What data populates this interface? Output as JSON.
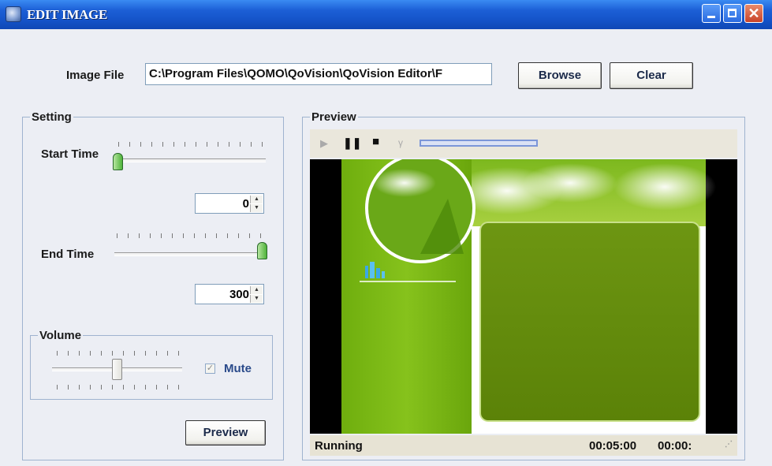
{
  "window": {
    "title": "EDIT IMAGE"
  },
  "image_file": {
    "label": "Image File",
    "value": "C:\\Program Files\\QOMO\\QoVision\\QoVision Editor\\F",
    "browse_label": "Browse",
    "clear_label": "Clear"
  },
  "setting": {
    "title": "Setting",
    "start_time_label": "Start Time",
    "start_time_value": "0",
    "end_time_label": "End Time",
    "end_time_value": "300",
    "volume_title": "Volume",
    "mute_label": "Mute",
    "mute_checked": true,
    "preview_button_label": "Preview"
  },
  "preview": {
    "title": "Preview",
    "status": "Running",
    "time_total": "00:05:00",
    "time_current": "00:00:"
  },
  "icons": [
    "app-icon",
    "minimize-icon",
    "maximize-icon",
    "close-icon",
    "play-icon",
    "pause-icon",
    "stop-icon",
    "volume-icon"
  ]
}
